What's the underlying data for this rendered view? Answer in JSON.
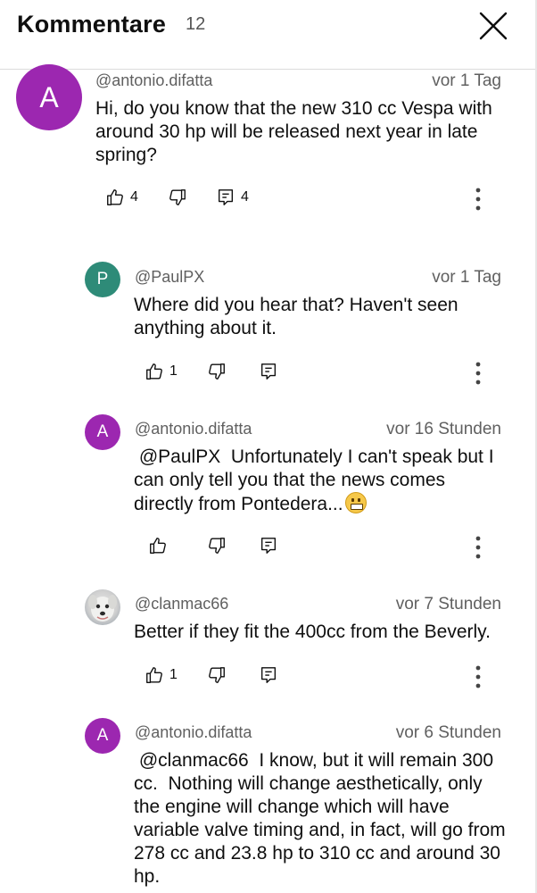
{
  "header": {
    "title": "Kommentare",
    "count": "12"
  },
  "comments": [
    {
      "avatar_letter": "A",
      "avatar_color": "#9c27b0",
      "author": "@antonio.difatta",
      "time": "vor 1 Tag",
      "text": "Hi, do you know that the new 310 cc Vespa with around 30 hp will be released next year in late spring?",
      "likes": "4",
      "replies": "4"
    },
    {
      "avatar_letter": "P",
      "avatar_color": "#2e8b78",
      "author": "@PaulPX",
      "time": "vor 1 Tag",
      "text": "Where did you hear that? Haven't seen anything about it.",
      "likes": "1"
    },
    {
      "avatar_letter": "A",
      "avatar_color": "#9c27b0",
      "author": "@antonio.difatta",
      "time": "vor 16 Stunden",
      "text": " @PaulPX  Unfortunately I can't speak but I can only tell you that the news comes directly from Pontedera...",
      "emoji": "grimacing-face-emoji"
    },
    {
      "avatar_icon": "dog-avatar",
      "author": "@clanmac66",
      "time": "vor 7 Stunden",
      "text": "Better if they fit the 400cc from the Beverly.",
      "likes": "1"
    },
    {
      "avatar_letter": "A",
      "avatar_color": "#9c27b0",
      "author": "@antonio.difatta",
      "time": "vor 6 Stunden",
      "text": " @clanmac66  I know, but it will remain 300 cc.  Nothing will change aesthetically, only the engine will change which will have variable valve timing and, in fact, will go from 278 cc and 23.8 hp to 310 cc and around 30 hp."
    }
  ],
  "icons": {
    "like": "thumb-up-icon",
    "dislike": "thumb-down-icon",
    "reply": "reply-icon",
    "more": "more-vert-icon",
    "close": "close-icon"
  }
}
